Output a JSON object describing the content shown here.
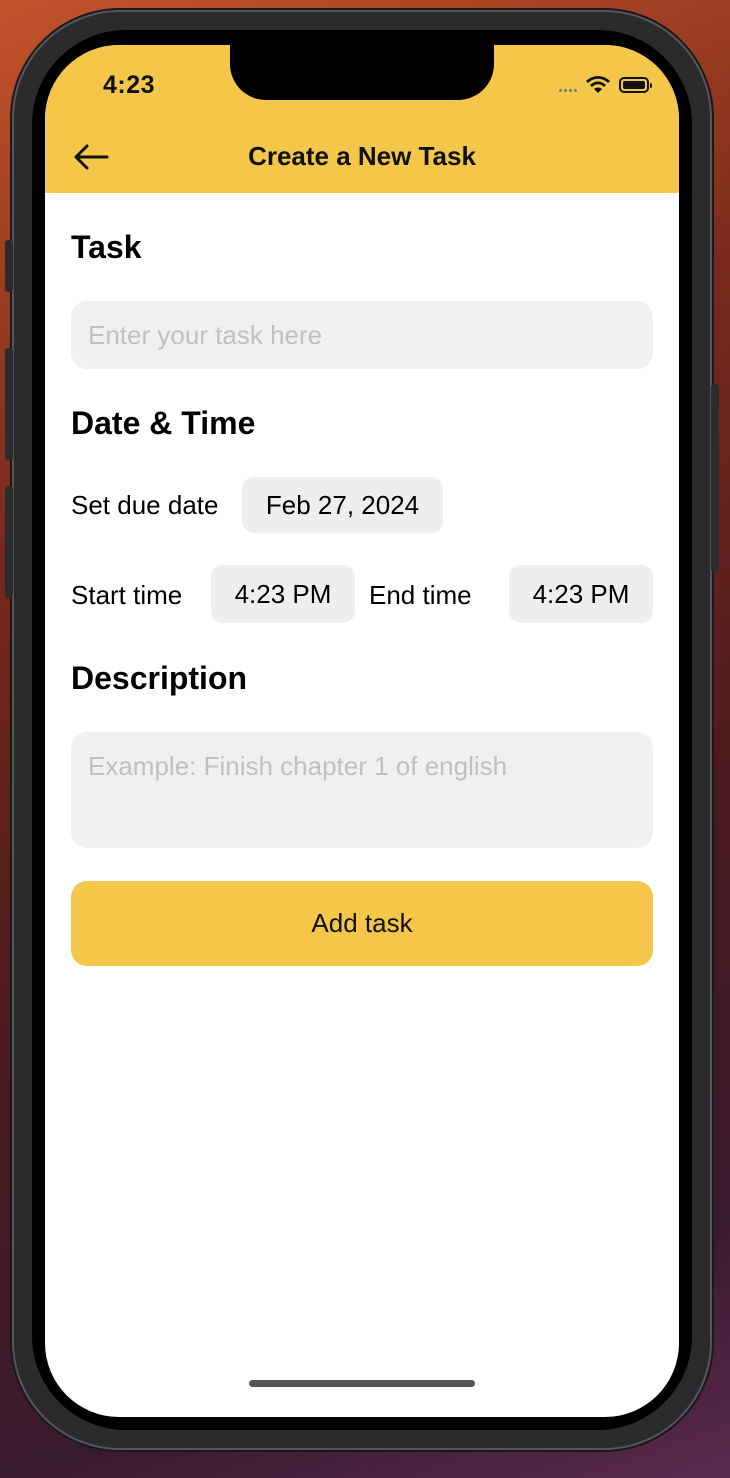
{
  "status_bar": {
    "time": "4:23",
    "icons": [
      "signal-dots-icon",
      "wifi-icon",
      "battery-icon"
    ]
  },
  "nav": {
    "back_icon": "arrow-left-icon",
    "title": "Create a New Task"
  },
  "task_section": {
    "title": "Task",
    "input_placeholder": "Enter your task here",
    "input_value": ""
  },
  "datetime_section": {
    "title": "Date & Time",
    "due_date_label": "Set due date",
    "due_date_value": "Feb 27, 2024",
    "start_time_label": "Start time",
    "start_time_value": "4:23 PM",
    "end_time_label": "End time",
    "end_time_value": "4:23 PM"
  },
  "description_section": {
    "title": "Description",
    "input_placeholder": "Example: Finish chapter 1 of english",
    "input_value": ""
  },
  "actions": {
    "add_task_label": "Add task"
  },
  "colors": {
    "accent": "#f4c64a",
    "input_bg": "#f0f0f0",
    "placeholder": "#c0c0c4"
  }
}
